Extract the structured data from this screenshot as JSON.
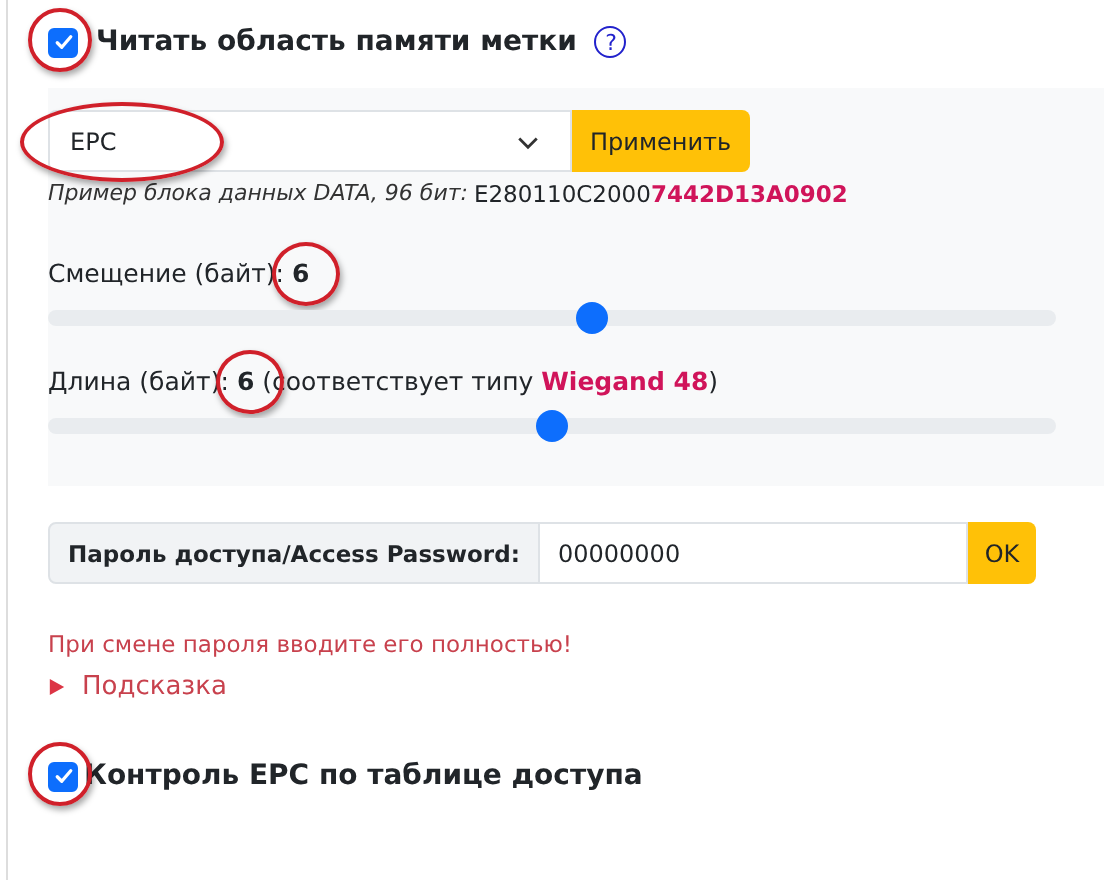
{
  "read_memory": {
    "checked": true,
    "circled": true,
    "label": "Читать область памяти метки",
    "help_icon": "?"
  },
  "memory_select": {
    "value": "EPC",
    "circled": true
  },
  "apply_button": "Применить",
  "sample": {
    "label": "Пример блока данных DATA, 96 бит:",
    "value": "E280110C2000**7442D13A0902**"
  },
  "offset": {
    "label": "Смещение (байт):",
    "value": "6",
    "circled": true,
    "level": 0.54
  },
  "length": {
    "label": "Длина (байт):",
    "value": "6",
    "circled": true,
    "note": "(соответствует типу **Wiegand 48**)",
    "level": 0.5
  },
  "password": {
    "label": "Пароль доступа/Access Password:",
    "value": "00000000",
    "button": "OK"
  },
  "warning": "При смене пароля вводите его полностью!",
  "hint": {
    "label": "Подсказка",
    "expanded": false
  },
  "epc_control": {
    "checked": true,
    "circled": true,
    "label": "Контроль EPC по таблице доступа"
  }
}
